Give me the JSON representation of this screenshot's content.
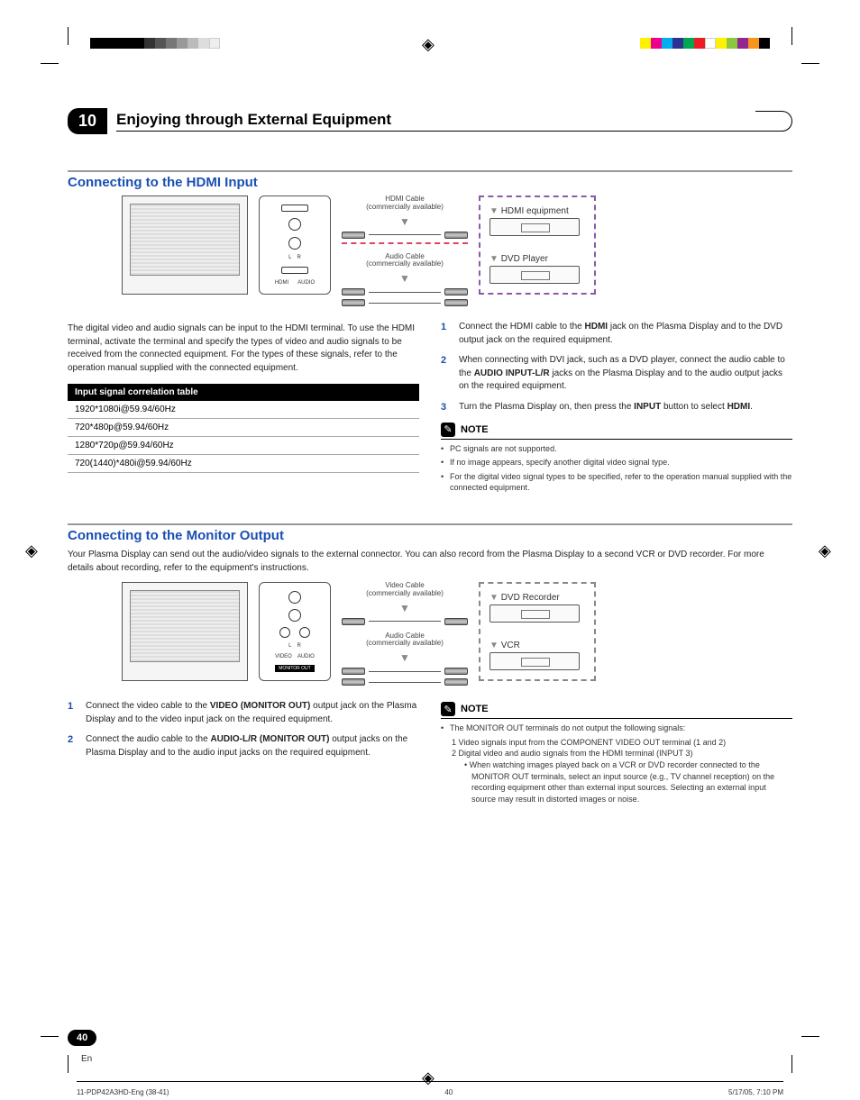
{
  "chapter": {
    "number": "10",
    "title": "Enjoying through External Equipment"
  },
  "hdmi": {
    "heading": "Connecting to the HDMI Input",
    "cable1_l1": "HDMI Cable",
    "cable1_l2": "(commercially available)",
    "cable2_l1": "Audio Cable",
    "cable2_l2": "(commercially available)",
    "dev1": "HDMI equipment",
    "dev2": "DVD Player",
    "port_labels": {
      "l": "L",
      "r": "R",
      "hdmi": "HDMI",
      "audio": "AUDIO"
    },
    "intro": "The digital video and audio signals can be input to the HDMI terminal. To use the HDMI terminal, activate the terminal and specify the types of video and audio signals to be received from the connected equipment. For the types of these signals, refer to the operation manual supplied with the connected equipment.",
    "table": {
      "header": "Input signal correlation table",
      "rows": [
        "1920*1080i@59.94/60Hz",
        "720*480p@59.94/60Hz",
        "1280*720p@59.94/60Hz",
        "720(1440)*480i@59.94/60Hz"
      ]
    },
    "steps": [
      {
        "n": "1",
        "pre": "Connect the HDMI cable to the ",
        "b1": "HDMI",
        "post": " jack on the Plasma Display and to the DVD output jack on the required equipment."
      },
      {
        "n": "2",
        "pre": "When connecting with DVI jack, such as a DVD player, connect the audio cable to the ",
        "b1": "AUDIO INPUT-L/R",
        "post": " jacks on the Plasma Display and to the audio output jacks on the required equipment."
      },
      {
        "n": "3",
        "pre": "Turn the Plasma Display on, then press the ",
        "b1": "INPUT",
        "mid": " button to select ",
        "b2": "HDMI",
        "post": "."
      }
    ],
    "note_label": "NOTE",
    "notes": [
      "PC signals are not supported.",
      "If no image appears, specify another digital video signal type.",
      "For the digital video signal types to be specified, refer to the operation manual supplied with the connected equipment."
    ]
  },
  "monitor": {
    "heading": "Connecting to the Monitor Output",
    "intro": "Your Plasma Display can send out the audio/video signals to the external connector. You can also record from the Plasma Display to a second VCR or DVD recorder. For more details about recording, refer to the equipment's instructions.",
    "cable1_l1": "Video Cable",
    "cable1_l2": "(commercially available)",
    "cable2_l1": "Audio Cable",
    "cable2_l2": "(commercially available)",
    "dev1": "DVD Recorder",
    "dev2": "VCR",
    "port_labels": {
      "l": "L",
      "r": "R",
      "video": "VIDEO",
      "audio": "AUDIO",
      "mon": "MONITOR OUT"
    },
    "steps": [
      {
        "n": "1",
        "pre": "Connect the video cable to the ",
        "b1": "VIDEO (MONITOR OUT)",
        "post": " output jack on the Plasma Display and to the video input jack on the required equipment."
      },
      {
        "n": "2",
        "pre": "Connect the audio cable to the ",
        "b1": "AUDIO-L/R (MONITOR OUT)",
        "post": " output jacks on the Plasma Display and to the audio input jacks on the required equipment."
      }
    ],
    "note_label": "NOTE",
    "note_main": "The MONITOR OUT terminals do not output the following signals:",
    "note_sub1": "1  Video signals input from the COMPONENT VIDEO OUT terminal (1 and 2)",
    "note_sub2": "2  Digital video and audio signals from the HDMI terminal (INPUT 3)",
    "note_bullet": "When watching images played back on a VCR or DVD recorder connected to the MONITOR OUT terminals, select an input source (e.g., TV channel reception) on the recording equipment other than external input sources. Selecting an external input source may result in distorted images or noise."
  },
  "page": {
    "num": "40",
    "lang": "En"
  },
  "footer": {
    "file": "11-PDP42A3HD-Eng (38-41)",
    "pnum": "40",
    "date": "5/17/05, 7:10 PM"
  },
  "colorbar1": [
    "#000",
    "#000",
    "#000",
    "#000",
    "#000",
    "#333",
    "#555",
    "#777",
    "#999",
    "#bbb",
    "#ddd",
    "#fff"
  ],
  "colorbar2": [
    "#00aeef",
    "#ec008c",
    "#fff200",
    "#000",
    "#00a651",
    "#2e3192",
    "#ed1c24",
    "#00aeef",
    "#92278f",
    "#f7941d",
    "#fff200",
    "#8dc63f"
  ]
}
